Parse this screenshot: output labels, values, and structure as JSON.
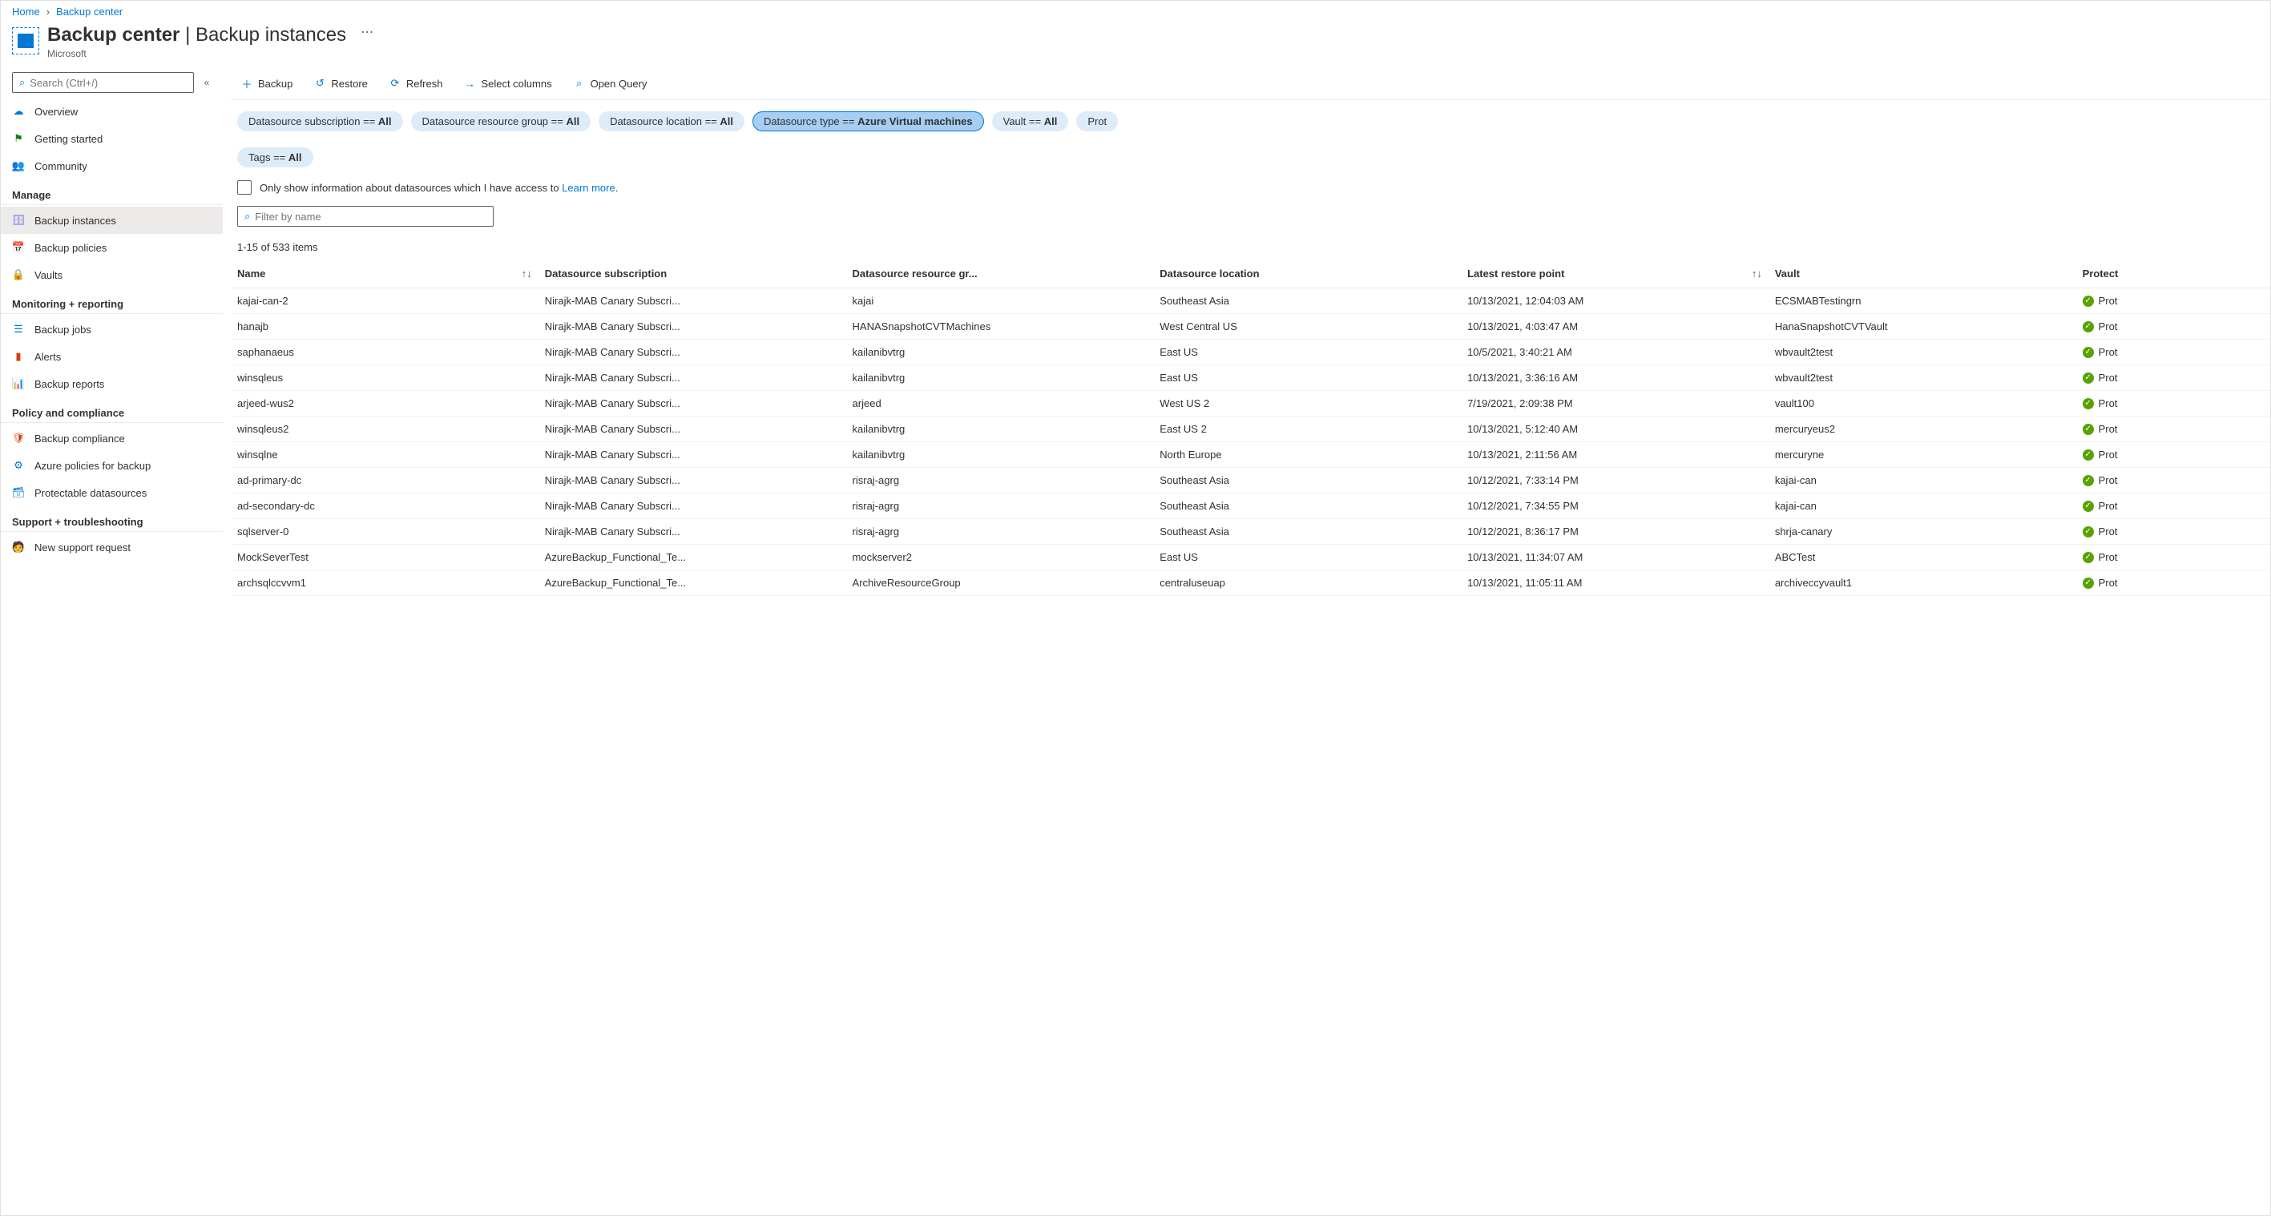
{
  "breadcrumb": [
    "Home",
    "Backup center"
  ],
  "header": {
    "title_bold": "Backup center",
    "title_rest": " | Backup instances",
    "subtitle": "Microsoft"
  },
  "sidebar": {
    "search_placeholder": "Search (Ctrl+/)",
    "top": [
      {
        "label": "Overview",
        "icon": "cloud"
      },
      {
        "label": "Getting started",
        "icon": "flag"
      },
      {
        "label": "Community",
        "icon": "people"
      }
    ],
    "groups": [
      {
        "label": "Manage",
        "items": [
          {
            "label": "Backup instances",
            "icon": "instances",
            "active": true
          },
          {
            "label": "Backup policies",
            "icon": "calendar"
          },
          {
            "label": "Vaults",
            "icon": "vault"
          }
        ]
      },
      {
        "label": "Monitoring + reporting",
        "items": [
          {
            "label": "Backup jobs",
            "icon": "list"
          },
          {
            "label": "Alerts",
            "icon": "alert"
          },
          {
            "label": "Backup reports",
            "icon": "chart"
          }
        ]
      },
      {
        "label": "Policy and compliance",
        "items": [
          {
            "label": "Backup compliance",
            "icon": "shield"
          },
          {
            "label": "Azure policies for backup",
            "icon": "policy"
          },
          {
            "label": "Protectable datasources",
            "icon": "db"
          }
        ]
      },
      {
        "label": "Support + troubleshooting",
        "items": [
          {
            "label": "New support request",
            "icon": "support"
          }
        ]
      }
    ]
  },
  "toolbar": [
    {
      "label": "Backup",
      "icon": "plus"
    },
    {
      "label": "Restore",
      "icon": "undo"
    },
    {
      "label": "Refresh",
      "icon": "refresh"
    },
    {
      "label": "Select columns",
      "icon": "columns"
    },
    {
      "label": "Open Query",
      "icon": "query"
    }
  ],
  "pills": [
    {
      "label": "Datasource subscription == ",
      "value": "All"
    },
    {
      "label": "Datasource resource group == ",
      "value": "All"
    },
    {
      "label": "Datasource location == ",
      "value": "All"
    },
    {
      "label": "Datasource type == ",
      "value": "Azure Virtual machines",
      "selected": true
    },
    {
      "label": "Vault == ",
      "value": "All"
    },
    {
      "label": "Prot",
      "value": ""
    },
    {
      "label": "Tags == ",
      "value": "All"
    }
  ],
  "info_row": {
    "text": "Only show information about datasources which I have access to ",
    "link": "Learn more"
  },
  "filter_placeholder": "Filter by name",
  "count_text": "1-15 of 533 items",
  "columns": [
    {
      "label": "Name",
      "sort": true
    },
    {
      "label": "Datasource subscription"
    },
    {
      "label": "Datasource resource gr..."
    },
    {
      "label": "Datasource location"
    },
    {
      "label": "Latest restore point",
      "sort": true
    },
    {
      "label": "Vault"
    },
    {
      "label": "Protect"
    }
  ],
  "rows": [
    {
      "name": "kajai-can-2",
      "sub": "Nirajk-MAB Canary Subscri...",
      "rg": "kajai",
      "loc": "Southeast Asia",
      "time": "10/13/2021, 12:04:03 AM",
      "vault": "ECSMABTestingrn",
      "prot": "Prot"
    },
    {
      "name": "hanajb",
      "sub": "Nirajk-MAB Canary Subscri...",
      "rg": "HANASnapshotCVTMachines",
      "loc": "West Central US",
      "time": "10/13/2021, 4:03:47 AM",
      "vault": "HanaSnapshotCVTVault",
      "prot": "Prot"
    },
    {
      "name": "saphanaeus",
      "sub": "Nirajk-MAB Canary Subscri...",
      "rg": "kailanibvtrg",
      "loc": "East US",
      "time": "10/5/2021, 3:40:21 AM",
      "vault": "wbvault2test",
      "prot": "Prot"
    },
    {
      "name": "winsqleus",
      "sub": "Nirajk-MAB Canary Subscri...",
      "rg": "kailanibvtrg",
      "loc": "East US",
      "time": "10/13/2021, 3:36:16 AM",
      "vault": "wbvault2test",
      "prot": "Prot"
    },
    {
      "name": "arjeed-wus2",
      "sub": "Nirajk-MAB Canary Subscri...",
      "rg": "arjeed",
      "loc": "West US 2",
      "time": "7/19/2021, 2:09:38 PM",
      "vault": "vault100",
      "prot": "Prot"
    },
    {
      "name": "winsqleus2",
      "sub": "Nirajk-MAB Canary Subscri...",
      "rg": "kailanibvtrg",
      "loc": "East US 2",
      "time": "10/13/2021, 5:12:40 AM",
      "vault": "mercuryeus2",
      "prot": "Prot"
    },
    {
      "name": "winsqlne",
      "sub": "Nirajk-MAB Canary Subscri...",
      "rg": "kailanibvtrg",
      "loc": "North Europe",
      "time": "10/13/2021, 2:11:56 AM",
      "vault": "mercuryne",
      "prot": "Prot"
    },
    {
      "name": "ad-primary-dc",
      "sub": "Nirajk-MAB Canary Subscri...",
      "rg": "risraj-agrg",
      "loc": "Southeast Asia",
      "time": "10/12/2021, 7:33:14 PM",
      "vault": "kajai-can",
      "prot": "Prot"
    },
    {
      "name": "ad-secondary-dc",
      "sub": "Nirajk-MAB Canary Subscri...",
      "rg": "risraj-agrg",
      "loc": "Southeast Asia",
      "time": "10/12/2021, 7:34:55 PM",
      "vault": "kajai-can",
      "prot": "Prot"
    },
    {
      "name": "sqlserver-0",
      "sub": "Nirajk-MAB Canary Subscri...",
      "rg": "risraj-agrg",
      "loc": "Southeast Asia",
      "time": "10/12/2021, 8:36:17 PM",
      "vault": "shrja-canary",
      "prot": "Prot"
    },
    {
      "name": "MockSeverTest",
      "sub": "AzureBackup_Functional_Te...",
      "rg": "mockserver2",
      "loc": "East US",
      "time": "10/13/2021, 11:34:07 AM",
      "vault": "ABCTest",
      "prot": "Prot"
    },
    {
      "name": "archsqlccvvm1",
      "sub": "AzureBackup_Functional_Te...",
      "rg": "ArchiveResourceGroup",
      "loc": "centraluseuap",
      "time": "10/13/2021, 11:05:11 AM",
      "vault": "archiveccyvault1",
      "prot": "Prot"
    }
  ],
  "icons": {
    "cloud": "☁",
    "flag": "⚑",
    "people": "👥",
    "instances": "🗄",
    "calendar": "📅",
    "vault": "🔒",
    "list": "☰",
    "alert": "▮",
    "chart": "📊",
    "shield": "🛡",
    "policy": "⚙",
    "db": "🗃",
    "support": "🧑",
    "search": "🔍",
    "plus": "＋",
    "undo": "↺",
    "refresh": "⟳",
    "columns": "→",
    "query": "⌕"
  }
}
